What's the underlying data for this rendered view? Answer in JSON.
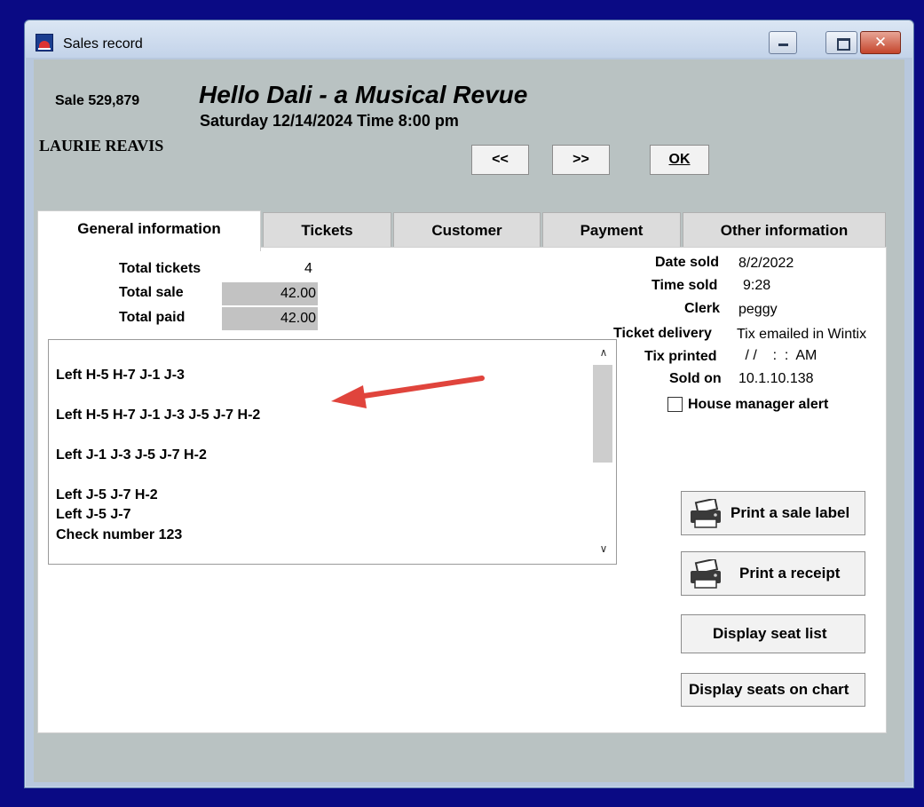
{
  "window": {
    "title": "Sales record"
  },
  "header": {
    "sale_number": "Sale 529,879",
    "show_title": "Hello Dali - a Musical Revue",
    "show_date": "Saturday 12/14/2024  Time 8:00 pm",
    "customer_name": "LAURIE REAVIS"
  },
  "nav": {
    "prev_label": "<<",
    "next_label": ">>",
    "ok_label": "OK"
  },
  "tabs": [
    {
      "label": "General information",
      "active": true
    },
    {
      "label": "Tickets",
      "active": false
    },
    {
      "label": "Customer",
      "active": false
    },
    {
      "label": "Payment",
      "active": false
    },
    {
      "label": "Other information",
      "active": false
    }
  ],
  "general": {
    "total_tickets_label": "Total tickets",
    "total_tickets_value": "4",
    "total_sale_label": "Total sale",
    "total_sale_value": "42.00",
    "total_paid_label": "Total paid",
    "total_paid_value": "42.00"
  },
  "notes": {
    "lines": [
      "Left H-5 H-7 J-1 J-3",
      "Left H-5 H-7 J-1 J-3 J-5 J-7 H-2",
      "Left J-1 J-3 J-5 J-7 H-2",
      "Left J-5 J-7 H-2",
      "Left J-5 J-7",
      "Check number 123"
    ]
  },
  "details": {
    "date_sold_label": "Date sold",
    "date_sold_value": "8/2/2022",
    "time_sold_label": "Time sold",
    "time_sold_value": "9:28",
    "clerk_label": "Clerk",
    "clerk_value": "peggy",
    "ticket_delivery_label": "Ticket delivery",
    "ticket_delivery_value": "Tix emailed in Wintix",
    "tix_printed_label": "Tix printed",
    "tix_printed_value": " / /    :  :  AM",
    "sold_on_label": "Sold on",
    "sold_on_value": "10.1.10.138",
    "house_manager_alert_label": "House manager alert",
    "house_manager_alert_checked": false
  },
  "actions": {
    "print_sale_label": "Print a sale label",
    "print_receipt": "Print a receipt",
    "display_seat_list": "Display seat list",
    "display_seats_chart": "Display seats on chart"
  },
  "colors": {
    "desktop": "#0a0a84",
    "client_bg": "#b9c2c2",
    "annotation_arrow": "#e0443c"
  }
}
